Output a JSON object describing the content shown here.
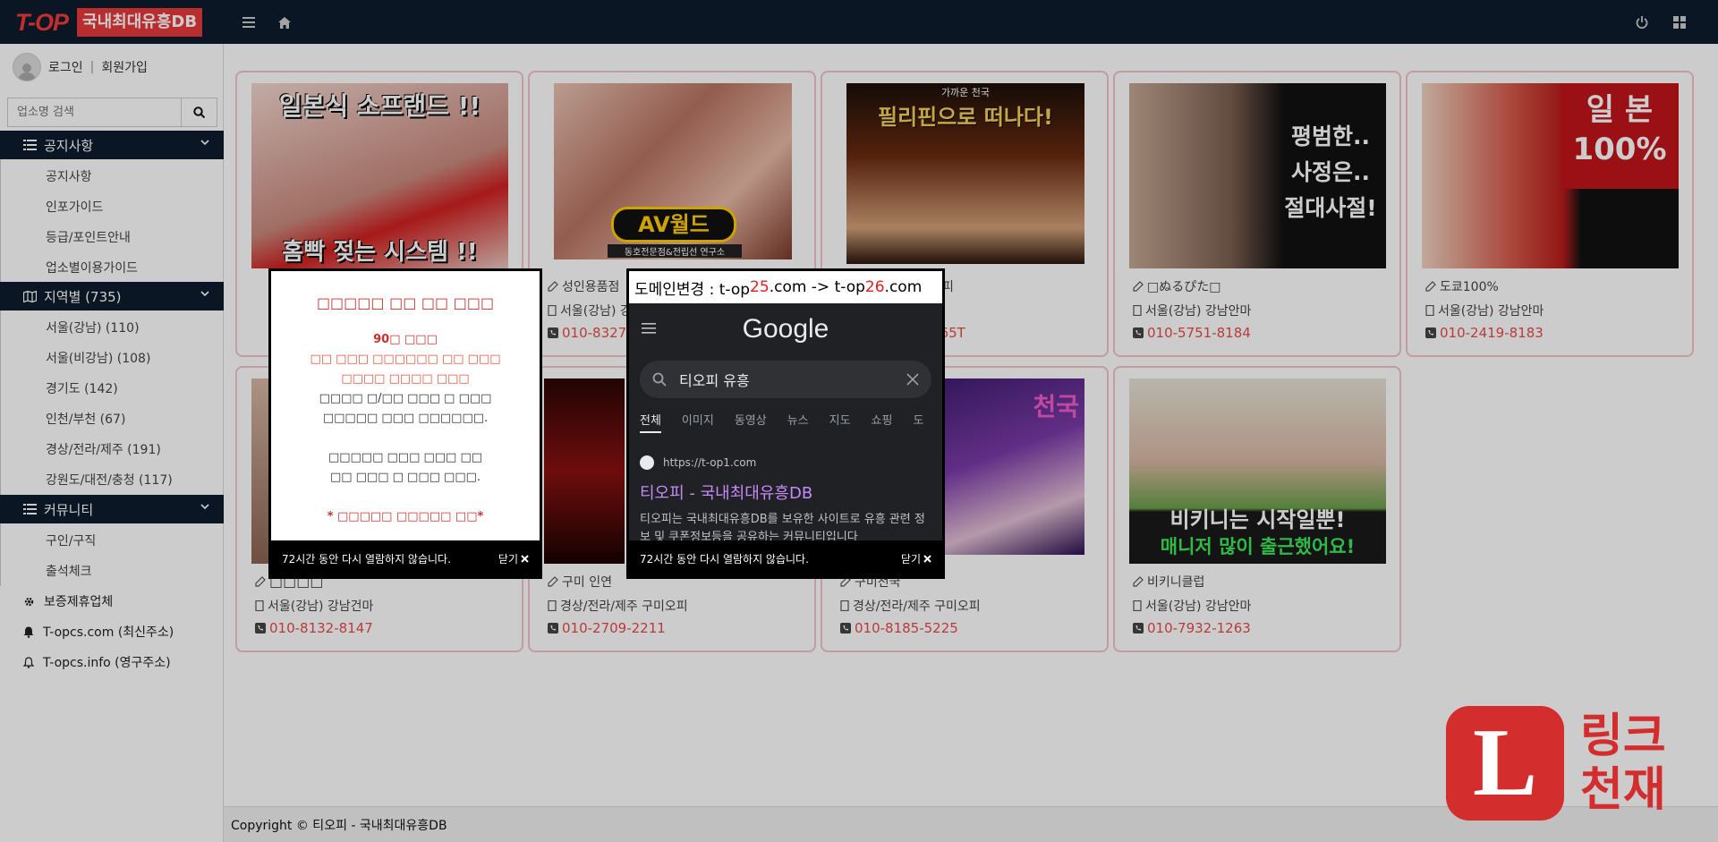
{
  "header": {
    "logo_top": "T-OP",
    "logo_sub": "국내최대유흥DB"
  },
  "sidebar": {
    "login": "로그인",
    "sep": "|",
    "signup": "회원가입",
    "search_placeholder": "업소명 검색",
    "notice": {
      "title": "공지사항",
      "items": [
        "공지사항",
        "인포가이드",
        "등급/포인트안내",
        "업소별이용가이드"
      ]
    },
    "region": {
      "title": "지역별 (735)",
      "items": [
        "서울(강남) (110)",
        "서울(비강남) (108)",
        "경기도 (142)",
        "인천/부천 (67)",
        "경상/전라/제주 (191)",
        "강원도/대전/충청 (117)"
      ]
    },
    "community": {
      "title": "커뮤니티",
      "items": [
        "구인/구직",
        "출석체크"
      ]
    },
    "extra": [
      "보증제휴업체",
      "T-opcs.com (최신주소)",
      "T-opcs.info (영구주소)"
    ]
  },
  "cards": [
    {
      "l1": "",
      "l2": "",
      "l3": "",
      "img_title": "일본식 소프랜드 !!",
      "img_sub": "홈빡 젖는 시스템 !!"
    },
    {
      "l1": "성인용품점",
      "l2": "서울(강남) 강",
      "l3": "010-8327",
      "img_title": "AV월드",
      "img_sub": "동호전문점&전립선 연구소"
    },
    {
      "l1": "피",
      "l2": "",
      "l3": "365T",
      "img_title": "필리핀으로 떠나다!",
      "img_sub": "가까운 천국"
    },
    {
      "l1": "□ぬるぴた□",
      "l2": "서울(강남) 강남안마",
      "l3": "010-5751-8184",
      "img_title": "평범한.. 사정은.. 절대사절!",
      "img_sub": ""
    },
    {
      "l1": "도쿄100%",
      "l2": "서울(강남) 강남안마",
      "l3": "010-2419-8183",
      "img_title": "일 본 100%",
      "img_sub": ""
    },
    {
      "l1": "□□□□",
      "l2": "서울(강남) 강남건마",
      "l3": "010-8132-8147",
      "img_title": "",
      "img_sub": ""
    },
    {
      "l1": "구미 인연",
      "l2": "경상/전라/제주 구미오피",
      "l3": "010-2709-2211",
      "img_title": "",
      "img_sub": ""
    },
    {
      "l1": "구미천국",
      "l2": "경상/전라/제주 구미오피",
      "l3": "010-8185-5225",
      "img_title": "천국",
      "img_sub": ""
    },
    {
      "l1": "비키니클럽",
      "l2": "서울(강남) 강남안마",
      "l3": "010-7932-1263",
      "img_title": "비키니는 시작일뿐!",
      "img_sub": "매니저 많이 출근했어요!"
    }
  ],
  "popup1": {
    "title": "□□□□□ □□ □□ □□□",
    "line1": "90□ □□□",
    "line2": "□□ □□□ □□□□□□ □□ □□□",
    "line3": "□□□□ □□□□ □□□",
    "line4": "□□□□ □/□□ □□□ □ □□□",
    "line5": "□□□□□ □□□ □□□□□□.",
    "line6": "□□□□□ □□□ □□□ □□",
    "line7": "□□ □□□ □ □□□ □□□.",
    "line8": "* □□□□□ □□□□□ □□*",
    "foot_text": "72시간 동안 다시 열람하지 않습니다.",
    "close": "닫기"
  },
  "popup2": {
    "header_pre": "도메인변경 : t-op",
    "header_n1": "25",
    "header_mid": ".com -> t-op",
    "header_n2": "26",
    "header_post": ".com",
    "google": "Google",
    "query": "티오피 유흥",
    "tabs": [
      "전체",
      "이미지",
      "동영상",
      "뉴스",
      "지도",
      "쇼핑",
      "도"
    ],
    "url": "https://t-op1.com",
    "result_title": "티오피 - 국내최대유흥DB",
    "result_desc": "티오피는 국내최대유흥DB를 보유한 사이트로 유흥 관련 정보 및 쿠폰정보등을 공유하는 커뮤니티입니다",
    "foot_text": "72시간 동안 다시 열람하지 않습니다.",
    "close": "닫기"
  },
  "badge": {
    "letter": "L",
    "line1": "링크",
    "line2": "천재"
  },
  "footer": {
    "text": "Copyright © 티오피 - 국내최대유흥DB"
  },
  "colors": {
    "nav_bg": "#0e1c2e",
    "accent_red": "#e8393b",
    "card_border": "#f4c2cc",
    "phone": "#e84a4a"
  }
}
